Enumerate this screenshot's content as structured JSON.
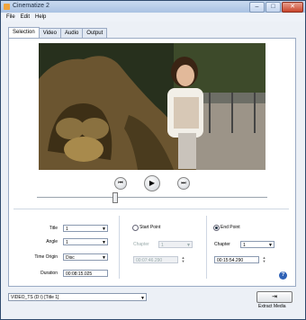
{
  "window": {
    "title": "Cinematize 2"
  },
  "menu": [
    "File",
    "Edit",
    "Help"
  ],
  "tabs": [
    "Selection",
    "Video",
    "Audio",
    "Output"
  ],
  "playback": {
    "prev": "⏮",
    "play": "▶",
    "next": "⏭"
  },
  "fields": {
    "title_label": "Title",
    "title_value": "1",
    "angle_label": "Angle",
    "angle_value": "1",
    "time_origin_label": "Time Origin",
    "time_origin_value": "Disc",
    "duration_label": "Duration",
    "duration_value": "00:08:15.025"
  },
  "start_point": {
    "label": "Start Point",
    "chapter_label": "Chapter",
    "chapter_value": "1",
    "time_value": "00:07:46.290"
  },
  "end_point": {
    "label": "End Point",
    "chapter_label": "Chapter",
    "chapter_value": "1",
    "time_value": "00:15:54.290"
  },
  "bottom": {
    "source": "VIDEO_TS (D:\\) [Title 1]",
    "extract_label": "Extract Media"
  }
}
